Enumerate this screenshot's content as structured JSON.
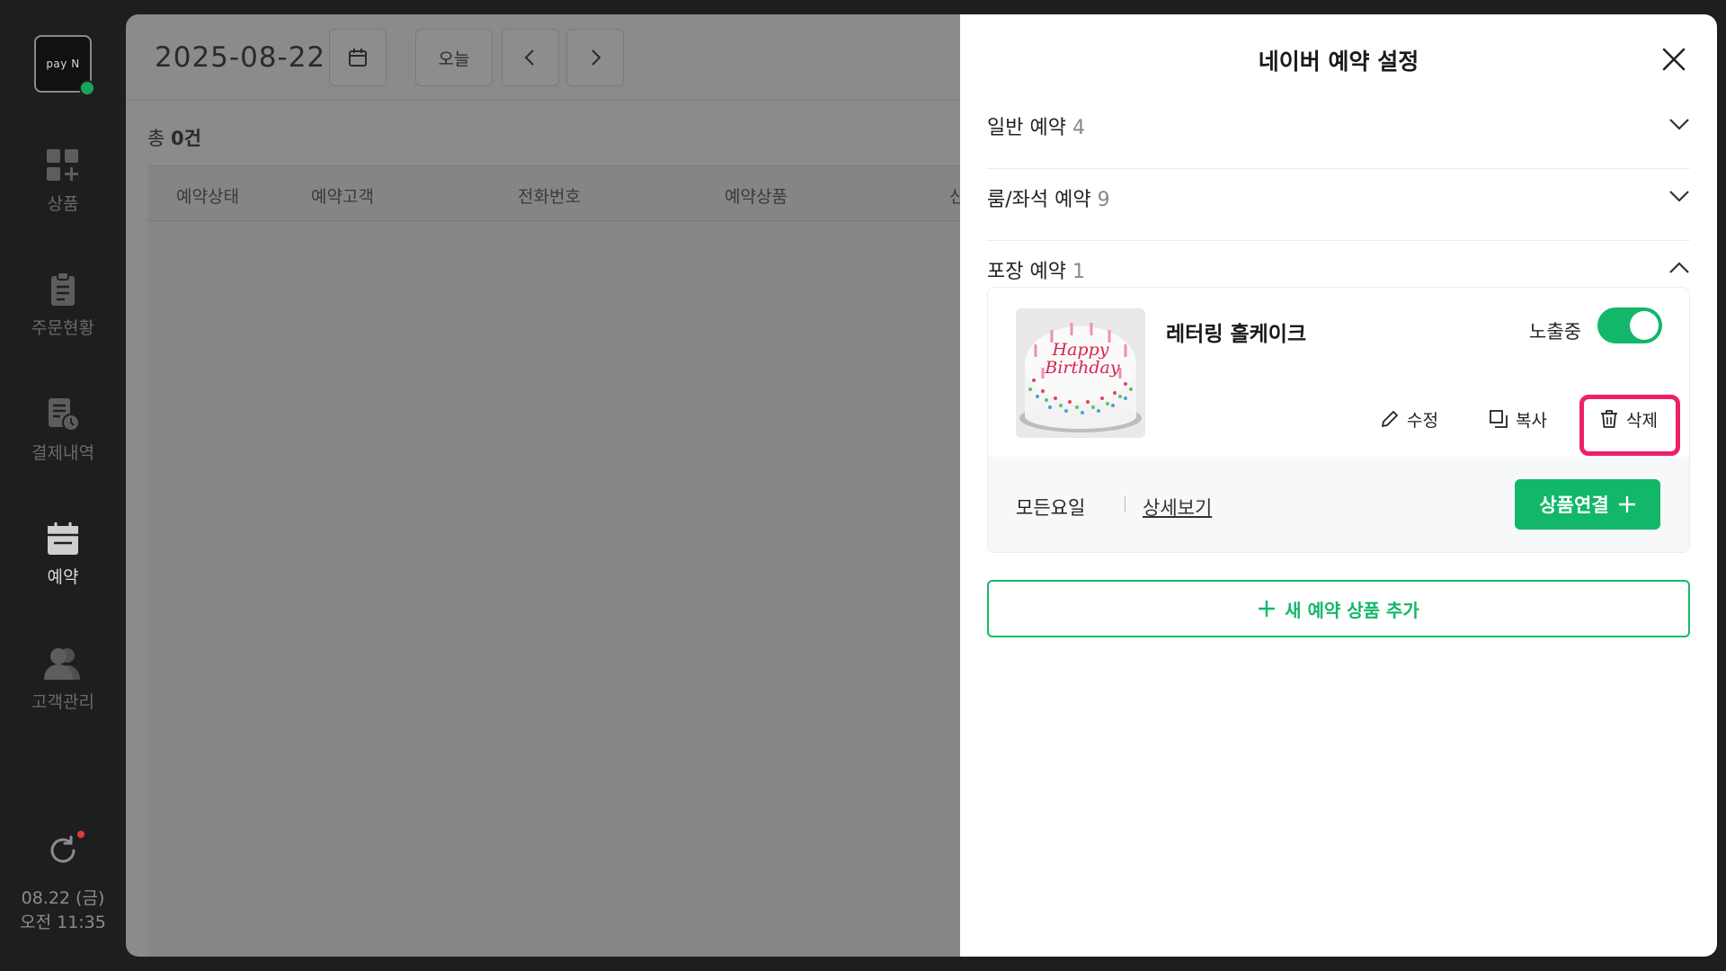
{
  "sidebar": {
    "logo_text": "pay N",
    "items": [
      {
        "label": "상품",
        "icon": "grid-plus-icon"
      },
      {
        "label": "주문현황",
        "icon": "clipboard-icon"
      },
      {
        "label": "결제내역",
        "icon": "receipt-clock-icon"
      },
      {
        "label": "예약",
        "icon": "calendar-icon"
      },
      {
        "label": "고객관리",
        "icon": "users-icon"
      }
    ],
    "active_item": "예약",
    "clock_date": "08.22 (금)",
    "clock_time": "오전 11:35"
  },
  "main": {
    "date": "2025-08-22",
    "today_button": "오늘",
    "count_prefix": "총",
    "count_value": "0건",
    "columns": [
      "예약상태",
      "예약고객",
      "전화번호",
      "예약상품",
      "신"
    ]
  },
  "panel": {
    "title": "네이버 예약 설정",
    "sections": [
      {
        "label": "일반 예약",
        "count": "4",
        "expanded": false
      },
      {
        "label": "룸/좌석 예약",
        "count": "9",
        "expanded": false
      },
      {
        "label": "포장 예약",
        "count": "1",
        "expanded": true
      }
    ],
    "product": {
      "name": "레터링 홀케이크",
      "exposure_label": "노출중",
      "exposure_on": true,
      "edit_label": "수정",
      "copy_label": "복사",
      "delete_label": "삭제",
      "days": "모든요일",
      "detail_link": "상세보기",
      "link_button": "상품연결",
      "cake_text_1": "Happy",
      "cake_text_2": "Birthday"
    },
    "add_button": "새 예약 상품 추가"
  },
  "colors": {
    "accent_green": "#12b76a",
    "highlight_pink": "#ee1f6b",
    "sidebar_bg": "#1e1e20"
  }
}
